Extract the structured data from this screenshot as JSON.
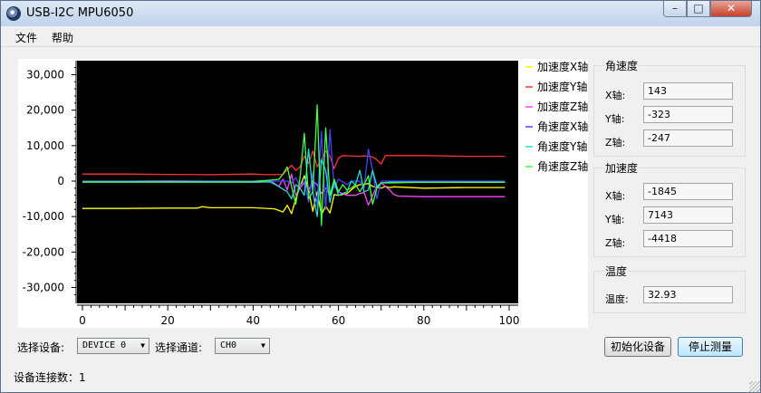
{
  "window": {
    "title": "USB-I2C MPU6050"
  },
  "titlebar": {
    "min_glyph": "–",
    "max_glyph": "□",
    "close_glyph": "✕"
  },
  "menu": {
    "items": [
      "文件",
      "帮助"
    ]
  },
  "chart_data": {
    "type": "line",
    "x_range": [
      0,
      100
    ],
    "ylim": [
      -33000,
      33000
    ],
    "x_ticks": [
      0,
      20,
      40,
      60,
      80,
      100
    ],
    "y_ticks": [
      30000,
      20000,
      10000,
      0,
      -10000,
      -20000,
      -30000
    ],
    "y_tick_labels": [
      "30,000",
      "20,000",
      "10,000",
      "0",
      "-10,000",
      "-20,000",
      "-30,000"
    ],
    "background": "#000000",
    "grid": false,
    "legend": "right",
    "series": [
      {
        "name": "加速度X轴",
        "color": "#ffff00",
        "points": [
          [
            0,
            -7700
          ],
          [
            10,
            -7700
          ],
          [
            20,
            -7600
          ],
          [
            27,
            -7600
          ],
          [
            28,
            -7200
          ],
          [
            30,
            -7500
          ],
          [
            40,
            -7500
          ],
          [
            45,
            -7800
          ],
          [
            47,
            -8700
          ],
          [
            48,
            -6800
          ],
          [
            49,
            -9200
          ],
          [
            50,
            -5000
          ],
          [
            51,
            -1500
          ],
          [
            52,
            1500
          ],
          [
            53,
            -2500
          ],
          [
            54,
            -8500
          ],
          [
            55,
            -3000
          ],
          [
            56,
            -9500
          ],
          [
            57,
            -7000
          ],
          [
            58,
            -9000
          ],
          [
            59,
            -3800
          ],
          [
            60,
            -4000
          ],
          [
            62,
            -3500
          ],
          [
            63,
            -2500
          ],
          [
            64,
            -1500
          ],
          [
            65,
            -1000
          ],
          [
            66,
            -900
          ],
          [
            67,
            -700
          ],
          [
            68,
            -1500
          ],
          [
            70,
            -2000
          ],
          [
            71,
            -1500
          ],
          [
            72,
            -1800
          ],
          [
            73,
            -1600
          ],
          [
            80,
            -2000
          ],
          [
            90,
            -1800
          ],
          [
            99,
            -1800
          ]
        ]
      },
      {
        "name": "加速度Y轴",
        "color": "#ff3333",
        "points": [
          [
            0,
            2000
          ],
          [
            10,
            2000
          ],
          [
            20,
            1900
          ],
          [
            30,
            1800
          ],
          [
            40,
            2000
          ],
          [
            43,
            1800
          ],
          [
            47,
            1900
          ],
          [
            49,
            4500
          ],
          [
            50,
            3000
          ],
          [
            51,
            4000
          ],
          [
            52,
            7000
          ],
          [
            53,
            5000
          ],
          [
            54,
            8500
          ],
          [
            55,
            4000
          ],
          [
            56,
            6000
          ],
          [
            57,
            8500
          ],
          [
            58,
            7000
          ],
          [
            59,
            3500
          ],
          [
            60,
            6500
          ],
          [
            61,
            7200
          ],
          [
            65,
            7000
          ],
          [
            66,
            7100
          ],
          [
            67,
            7000
          ],
          [
            68,
            6800
          ],
          [
            69,
            6000
          ],
          [
            70,
            4800
          ],
          [
            71,
            7200
          ],
          [
            80,
            7200
          ],
          [
            90,
            7000
          ],
          [
            99,
            7000
          ]
        ]
      },
      {
        "name": "加速度Z轴",
        "color": "#ff44ff",
        "points": [
          [
            0,
            0
          ],
          [
            10,
            0
          ],
          [
            20,
            100
          ],
          [
            30,
            0
          ],
          [
            40,
            0
          ],
          [
            44,
            200
          ],
          [
            46,
            -1500
          ],
          [
            47,
            500
          ],
          [
            48,
            -2500
          ],
          [
            49,
            2000
          ],
          [
            50,
            -4000
          ],
          [
            51,
            -2000
          ],
          [
            52,
            -500
          ],
          [
            53,
            -2500
          ],
          [
            54,
            0
          ],
          [
            55,
            -1000
          ],
          [
            56,
            -3500
          ],
          [
            57,
            -2000
          ],
          [
            58,
            -4000
          ],
          [
            59,
            -1000
          ],
          [
            60,
            -3000
          ],
          [
            62,
            -4000
          ],
          [
            64,
            -4000
          ],
          [
            65,
            -3500
          ],
          [
            66,
            -3200
          ],
          [
            67,
            -6800
          ],
          [
            68,
            -4000
          ],
          [
            69,
            -1500
          ],
          [
            70,
            -500
          ],
          [
            71,
            -1500
          ],
          [
            72,
            -2500
          ],
          [
            73,
            -3800
          ],
          [
            74,
            -4200
          ],
          [
            80,
            -4400
          ],
          [
            90,
            -4400
          ],
          [
            99,
            -4400
          ]
        ]
      },
      {
        "name": "角速度X轴",
        "color": "#4444ff",
        "points": [
          [
            0,
            0
          ],
          [
            20,
            0
          ],
          [
            40,
            0
          ],
          [
            48,
            0
          ],
          [
            49,
            -500
          ],
          [
            50,
            1000
          ],
          [
            51,
            -1500
          ],
          [
            52,
            0
          ],
          [
            53,
            -6000
          ],
          [
            54,
            2500
          ],
          [
            55,
            -7000
          ],
          [
            56,
            14000
          ],
          [
            57,
            -8000
          ],
          [
            58,
            14500
          ],
          [
            59,
            -2000
          ],
          [
            60,
            500
          ],
          [
            62,
            -1000
          ],
          [
            63,
            0
          ],
          [
            65,
            0
          ],
          [
            66,
            -2000
          ],
          [
            67,
            9000
          ],
          [
            68,
            3000
          ],
          [
            69,
            -5000
          ],
          [
            70,
            0
          ],
          [
            72,
            0
          ],
          [
            80,
            0
          ],
          [
            99,
            0
          ]
        ]
      },
      {
        "name": "角速度Y轴",
        "color": "#22dddd",
        "points": [
          [
            0,
            -300
          ],
          [
            20,
            -300
          ],
          [
            40,
            -300
          ],
          [
            44,
            -200
          ],
          [
            46,
            -1500
          ],
          [
            48,
            -3000
          ],
          [
            49,
            -5000
          ],
          [
            50,
            -1000
          ],
          [
            51,
            -2000
          ],
          [
            52,
            -4000
          ],
          [
            53,
            9000
          ],
          [
            54,
            -3000
          ],
          [
            55,
            -10000
          ],
          [
            56,
            6000
          ],
          [
            57,
            3000
          ],
          [
            58,
            -6000
          ],
          [
            59,
            0
          ],
          [
            60,
            -4000
          ],
          [
            62,
            -3000
          ],
          [
            63,
            0
          ],
          [
            64,
            -1000
          ],
          [
            65,
            3000
          ],
          [
            66,
            -3000
          ],
          [
            67,
            -2500
          ],
          [
            68,
            3000
          ],
          [
            69,
            -1500
          ],
          [
            70,
            -500
          ],
          [
            72,
            -300
          ],
          [
            80,
            -300
          ],
          [
            99,
            -300
          ]
        ]
      },
      {
        "name": "角速度Z轴",
        "color": "#44ff44",
        "points": [
          [
            0,
            -200
          ],
          [
            20,
            -200
          ],
          [
            40,
            -200
          ],
          [
            46,
            500
          ],
          [
            47,
            2000
          ],
          [
            48,
            4000
          ],
          [
            49,
            -1500
          ],
          [
            50,
            -6500
          ],
          [
            51,
            1000
          ],
          [
            52,
            13500
          ],
          [
            53,
            -5000
          ],
          [
            54,
            -3000
          ],
          [
            55,
            21500
          ],
          [
            56,
            -12500
          ],
          [
            57,
            15000
          ],
          [
            58,
            -4000
          ],
          [
            59,
            500
          ],
          [
            60,
            -3000
          ],
          [
            61,
            -1000
          ],
          [
            62,
            -2500
          ],
          [
            63,
            -2000
          ],
          [
            64,
            -1000
          ],
          [
            65,
            -3000
          ],
          [
            66,
            -1000
          ],
          [
            67,
            1500
          ],
          [
            68,
            -6500
          ],
          [
            69,
            -2000
          ],
          [
            70,
            -500
          ],
          [
            72,
            -500
          ],
          [
            80,
            -300
          ],
          [
            90,
            -300
          ],
          [
            99,
            -300
          ]
        ]
      }
    ]
  },
  "gyro": {
    "title": "角速度",
    "x_label": "X轴:",
    "x_value": "143",
    "y_label": "Y轴:",
    "y_value": "-323",
    "z_label": "Z轴:",
    "z_value": "-247"
  },
  "accel": {
    "title": "加速度",
    "x_label": "X轴:",
    "x_value": "-1845",
    "y_label": "Y轴:",
    "y_value": "7143",
    "z_label": "Z轴:",
    "z_value": "-4418"
  },
  "temp": {
    "title": "温度",
    "label": "温度:",
    "value": "32.93"
  },
  "controls": {
    "device_label": "选择设备:",
    "device_value": "DEVICE 0",
    "channel_label": "选择通道:",
    "channel_value": "CH0",
    "combo_arrow": "▼",
    "init_button": "初始化设备",
    "stop_button": "停止测量"
  },
  "status": {
    "text": "设备连接数：1"
  }
}
